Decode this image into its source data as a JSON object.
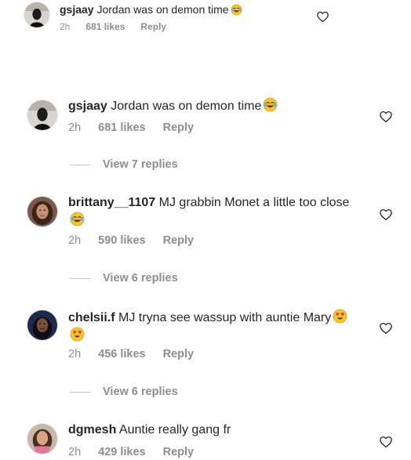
{
  "top_preview": {
    "username": "gsjaay",
    "text": "Jordan was on demon time",
    "emoji": "laughing-tears",
    "time": "2h",
    "likes": "681 likes",
    "reply": "Reply"
  },
  "comments": [
    {
      "username": "gsjaay",
      "text": "Jordan was on demon time",
      "emoji": "laughing-tears",
      "time": "2h",
      "likes": "681 likes",
      "reply": "Reply",
      "view_replies": "View 7 replies"
    },
    {
      "username": "brittany__1107",
      "text": "MJ grabbin Monet a little too close",
      "emoji": "laughing-tears",
      "time": "2h",
      "likes": "590 likes",
      "reply": "Reply",
      "view_replies": "View 6 replies"
    },
    {
      "username": "chelsii.f",
      "text": "MJ tryna see wassup with auntie Mary",
      "emoji": "heart-eyes heart-eyes",
      "time": "2h",
      "likes": "456 likes",
      "reply": "Reply",
      "view_replies": "View 6 replies"
    },
    {
      "username": "dgmesh",
      "text": "Auntie really gang fr",
      "time": "2h",
      "likes": "429 likes",
      "reply": "Reply"
    }
  ],
  "icons": {
    "like": "heart-outline-icon"
  },
  "colors": {
    "text": "#262626",
    "secondary": "#8e8e8e",
    "divider": "#c7c7c7",
    "background": "#ffffff"
  }
}
